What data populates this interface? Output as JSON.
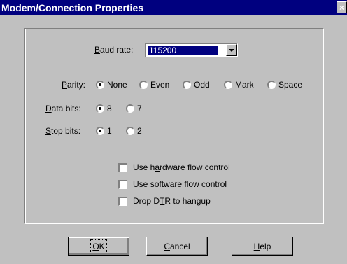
{
  "window": {
    "title": "Modem/Connection Properties",
    "close_glyph": "×"
  },
  "baud": {
    "label_prefix": "",
    "label_mnemonic": "B",
    "label_rest": "aud rate:",
    "value": "115200"
  },
  "parity": {
    "label_mnemonic": "P",
    "label_rest": "arity:",
    "options": [
      "None",
      "Even",
      "Odd",
      "Mark",
      "Space"
    ],
    "selected": "None"
  },
  "data_bits": {
    "label_mnemonic": "D",
    "label_rest": "ata bits:",
    "options": [
      "8",
      "7"
    ],
    "selected": "8"
  },
  "stop_bits": {
    "label_mnemonic": "S",
    "label_rest": "top bits:",
    "options": [
      "1",
      "2"
    ],
    "selected": "1"
  },
  "checkboxes": {
    "hardware": {
      "pre": "Use h",
      "mnemonic": "a",
      "post": "rdware flow control",
      "checked": false
    },
    "software": {
      "pre": "Use ",
      "mnemonic": "s",
      "post": "oftware flow control",
      "checked": false
    },
    "dtr": {
      "pre": "Drop D",
      "mnemonic": "T",
      "post": "R to hangup",
      "checked": false
    }
  },
  "buttons": {
    "ok": {
      "mnemonic": "O",
      "rest": "K"
    },
    "cancel": {
      "mnemonic": "C",
      "rest": "ancel"
    },
    "help": {
      "mnemonic": "H",
      "rest": "elp"
    }
  }
}
